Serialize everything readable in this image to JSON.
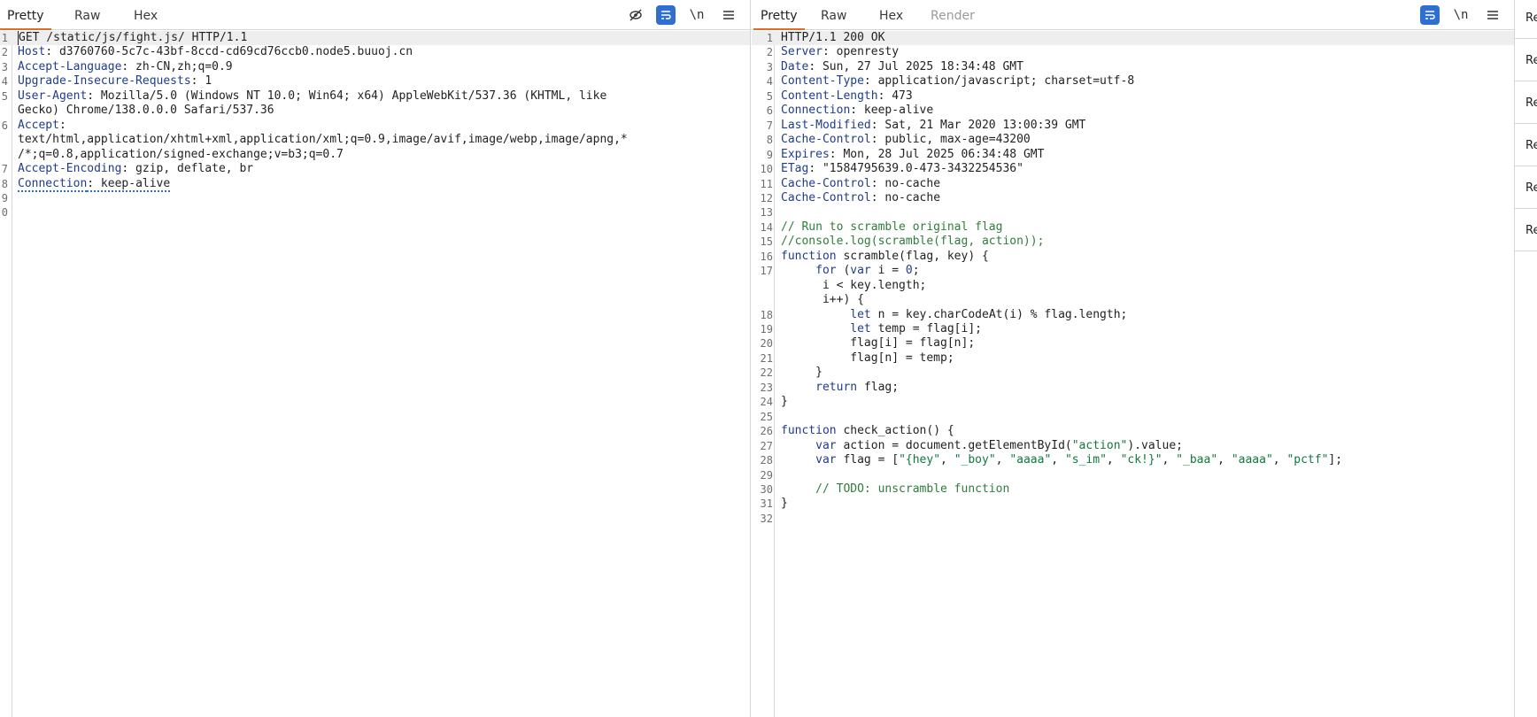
{
  "request": {
    "tabs": [
      "Pretty",
      "Raw",
      "Hex"
    ],
    "active_tab": "Pretty",
    "toolbar": {
      "hide_icon": "eye-off-icon",
      "wrap_icon": "wrap-lines-icon",
      "newline_label": "\\n",
      "menu_icon": "hamburger-icon"
    },
    "lines": [
      {
        "n": "1",
        "parts": [
          {
            "t": "GET /static/js/fight.js/ HTTP/1.1"
          }
        ],
        "highlight": true,
        "caret": true
      },
      {
        "n": "2",
        "parts": [
          {
            "t": "Host",
            "c": "hname"
          },
          {
            "t": ": d3760760-5c7c-43bf-8ccd-cd69cd76ccb0.node5.buuoj.cn"
          }
        ]
      },
      {
        "n": "3",
        "parts": [
          {
            "t": "Accept-Language",
            "c": "hname"
          },
          {
            "t": ": zh-CN,zh;q=0.9"
          }
        ]
      },
      {
        "n": "4",
        "parts": [
          {
            "t": "Upgrade-Insecure-Requests",
            "c": "hname"
          },
          {
            "t": ": 1"
          }
        ]
      },
      {
        "n": "5",
        "parts": [
          {
            "t": "User-Agent",
            "c": "hname"
          },
          {
            "t": ": Mozilla/5.0 (Windows NT 10.0; Win64; x64) AppleWebKit/537.36 (KHTML, like"
          }
        ]
      },
      {
        "n": "",
        "parts": [
          {
            "t": "Gecko) Chrome/138.0.0.0 Safari/537.36"
          }
        ]
      },
      {
        "n": "6",
        "parts": [
          {
            "t": "Accept",
            "c": "hname"
          },
          {
            "t": ":"
          }
        ]
      },
      {
        "n": "",
        "parts": [
          {
            "t": "text/html,application/xhtml+xml,application/xml;q=0.9,image/avif,image/webp,image/apng,*"
          }
        ]
      },
      {
        "n": "",
        "parts": [
          {
            "t": "/*;q=0.8,application/signed-exchange;v=b3;q=0.7"
          }
        ]
      },
      {
        "n": "7",
        "parts": [
          {
            "t": "Accept-Encoding",
            "c": "hname"
          },
          {
            "t": ": gzip, deflate, br"
          }
        ]
      },
      {
        "n": "8",
        "parts": [
          {
            "t": "Connection",
            "c": "hname dotted"
          },
          {
            "t": ": keep-alive",
            "c": "dotted"
          }
        ]
      },
      {
        "n": "9",
        "parts": []
      },
      {
        "n": "0",
        "parts": []
      }
    ]
  },
  "response": {
    "tabs": [
      "Pretty",
      "Raw",
      "Hex",
      "Render"
    ],
    "active_tab": "Pretty",
    "toolbar": {
      "wrap_icon": "wrap-lines-icon",
      "newline_label": "\\n",
      "menu_icon": "hamburger-icon"
    },
    "lines": [
      {
        "n": "1",
        "parts": [
          {
            "t": "HTTP/1.1 200 OK"
          }
        ],
        "highlight": true
      },
      {
        "n": "2",
        "parts": [
          {
            "t": "Server",
            "c": "hname"
          },
          {
            "t": ": openresty"
          }
        ]
      },
      {
        "n": "3",
        "parts": [
          {
            "t": "Date",
            "c": "hname"
          },
          {
            "t": ": Sun, 27 Jul 2025 18:34:48 GMT"
          }
        ]
      },
      {
        "n": "4",
        "parts": [
          {
            "t": "Content-Type",
            "c": "hname"
          },
          {
            "t": ": application/javascript; charset=utf-8"
          }
        ]
      },
      {
        "n": "5",
        "parts": [
          {
            "t": "Content-Length",
            "c": "hname"
          },
          {
            "t": ": 473"
          }
        ]
      },
      {
        "n": "6",
        "parts": [
          {
            "t": "Connection",
            "c": "hname"
          },
          {
            "t": ": keep-alive"
          }
        ]
      },
      {
        "n": "7",
        "parts": [
          {
            "t": "Last-Modified",
            "c": "hname"
          },
          {
            "t": ": Sat, 21 Mar 2020 13:00:39 GMT"
          }
        ]
      },
      {
        "n": "8",
        "parts": [
          {
            "t": "Cache-Control",
            "c": "hname"
          },
          {
            "t": ": public, max-age=43200"
          }
        ]
      },
      {
        "n": "9",
        "parts": [
          {
            "t": "Expires",
            "c": "hname"
          },
          {
            "t": ": Mon, 28 Jul 2025 06:34:48 GMT"
          }
        ]
      },
      {
        "n": "10",
        "parts": [
          {
            "t": "ETag",
            "c": "hname"
          },
          {
            "t": ": \"1584795639.0-473-3432254536\""
          }
        ]
      },
      {
        "n": "11",
        "parts": [
          {
            "t": "Cache-Control",
            "c": "hname"
          },
          {
            "t": ": no-cache"
          }
        ]
      },
      {
        "n": "12",
        "parts": [
          {
            "t": "Cache-Control",
            "c": "hname"
          },
          {
            "t": ": no-cache"
          }
        ]
      },
      {
        "n": "13",
        "parts": []
      },
      {
        "n": "14",
        "parts": [
          {
            "t": "// Run to scramble original flag",
            "c": "cm"
          }
        ]
      },
      {
        "n": "15",
        "parts": [
          {
            "t": "//console.log(scramble(flag, action));",
            "c": "cm"
          }
        ]
      },
      {
        "n": "16",
        "parts": [
          {
            "t": "function",
            "c": "kw"
          },
          {
            "t": " scramble(flag, key) {"
          }
        ]
      },
      {
        "n": "17",
        "parts": [
          {
            "t": "     "
          },
          {
            "t": "for",
            "c": "kw"
          },
          {
            "t": " ("
          },
          {
            "t": "var",
            "c": "kw"
          },
          {
            "t": " i = "
          },
          {
            "t": "0",
            "c": "num"
          },
          {
            "t": ";"
          }
        ]
      },
      {
        "n": "",
        "parts": [
          {
            "t": "      i < key.length;"
          }
        ]
      },
      {
        "n": "",
        "parts": [
          {
            "t": "      i++) {"
          }
        ]
      },
      {
        "n": "18",
        "parts": [
          {
            "t": "          "
          },
          {
            "t": "let",
            "c": "kw"
          },
          {
            "t": " n = key.charCodeAt(i) % flag.length;"
          }
        ]
      },
      {
        "n": "19",
        "parts": [
          {
            "t": "          "
          },
          {
            "t": "let",
            "c": "kw"
          },
          {
            "t": " temp = flag[i];"
          }
        ]
      },
      {
        "n": "20",
        "parts": [
          {
            "t": "          flag[i] = flag[n];"
          }
        ]
      },
      {
        "n": "21",
        "parts": [
          {
            "t": "          flag[n] = temp;"
          }
        ]
      },
      {
        "n": "22",
        "parts": [
          {
            "t": "     }"
          }
        ]
      },
      {
        "n": "23",
        "parts": [
          {
            "t": "     "
          },
          {
            "t": "return",
            "c": "kw"
          },
          {
            "t": " flag;"
          }
        ]
      },
      {
        "n": "24",
        "parts": [
          {
            "t": "}"
          }
        ]
      },
      {
        "n": "25",
        "parts": []
      },
      {
        "n": "26",
        "parts": [
          {
            "t": "function",
            "c": "kw"
          },
          {
            "t": " check_action() {"
          }
        ]
      },
      {
        "n": "27",
        "parts": [
          {
            "t": "     "
          },
          {
            "t": "var",
            "c": "kw"
          },
          {
            "t": " action = document.getElementById("
          },
          {
            "t": "\"action\"",
            "c": "str"
          },
          {
            "t": ").value;"
          }
        ]
      },
      {
        "n": "28",
        "parts": [
          {
            "t": "     "
          },
          {
            "t": "var",
            "c": "kw"
          },
          {
            "t": " flag = ["
          },
          {
            "t": "\"{hey\"",
            "c": "str"
          },
          {
            "t": ", "
          },
          {
            "t": "\"_boy\"",
            "c": "str"
          },
          {
            "t": ", "
          },
          {
            "t": "\"aaaa\"",
            "c": "str"
          },
          {
            "t": ", "
          },
          {
            "t": "\"s_im\"",
            "c": "str"
          },
          {
            "t": ", "
          },
          {
            "t": "\"ck!}\"",
            "c": "str"
          },
          {
            "t": ", "
          },
          {
            "t": "\"_baa\"",
            "c": "str"
          },
          {
            "t": ", "
          },
          {
            "t": "\"aaaa\"",
            "c": "str"
          },
          {
            "t": ", "
          },
          {
            "t": "\"pctf\"",
            "c": "str"
          },
          {
            "t": "];"
          }
        ]
      },
      {
        "n": "29",
        "parts": []
      },
      {
        "n": "30",
        "parts": [
          {
            "t": "     "
          },
          {
            "t": "// TODO: unscramble function",
            "c": "cm"
          }
        ]
      },
      {
        "n": "31",
        "parts": [
          {
            "t": "}"
          }
        ]
      },
      {
        "n": "32",
        "parts": []
      }
    ]
  },
  "side_panel": {
    "items": [
      "Re",
      "Re",
      "Re",
      "Re",
      "Re",
      "Re"
    ]
  },
  "colors": {
    "accent_tab_underline": "#e06c2b",
    "header_name": "#1f3d8a",
    "string": "#0f7a3c",
    "comment": "#2f7d3a",
    "wrap_button": "#2f6fd0"
  }
}
